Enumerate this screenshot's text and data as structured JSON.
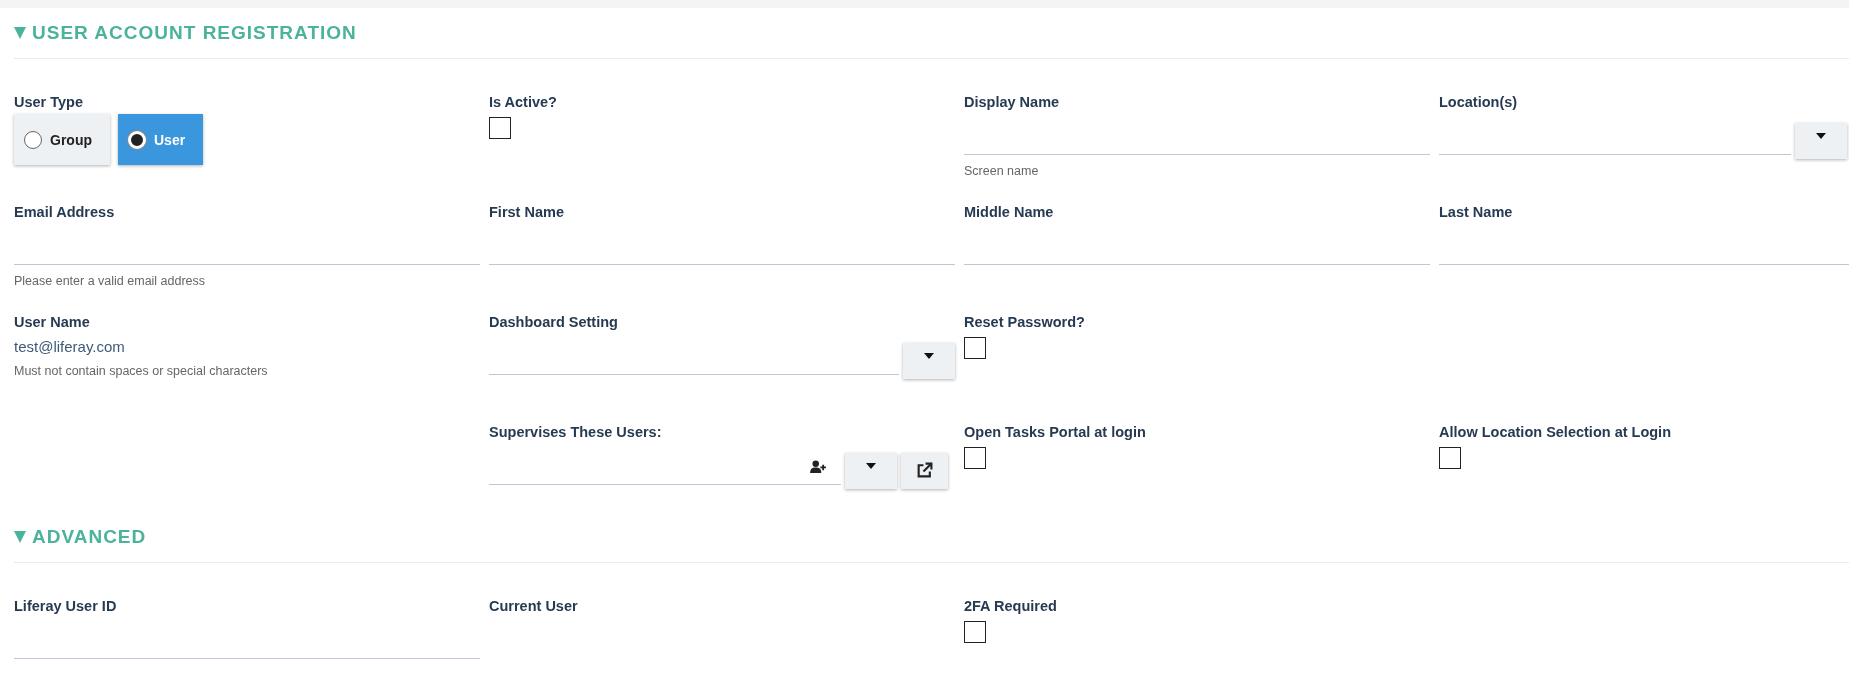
{
  "sections": [
    {
      "title": "USER ACCOUNT REGISTRATION",
      "expanded": true,
      "rows": [
        [
          {
            "kind": "radio-group",
            "label": "User Type",
            "options": [
              {
                "label": "Group",
                "selected": false
              },
              {
                "label": "User",
                "selected": true
              }
            ]
          },
          {
            "kind": "checkbox",
            "label": "Is Active?",
            "checked": false
          },
          {
            "kind": "text",
            "label": "Display Name",
            "help": "Screen name"
          },
          {
            "kind": "picker",
            "label": "Location(s)"
          }
        ],
        [
          {
            "kind": "text",
            "label": "Email Address",
            "help": "Please enter a valid email address"
          },
          {
            "kind": "text",
            "label": "First Name"
          },
          {
            "kind": "text",
            "label": "Middle Name"
          },
          {
            "kind": "text",
            "label": "Last Name"
          }
        ],
        [
          {
            "kind": "static",
            "label": "User Name",
            "value": "test@liferay.com",
            "help": "Must not contain spaces or special characters"
          },
          {
            "kind": "select",
            "label": "Dashboard Setting"
          },
          {
            "kind": "checkbox",
            "label": "Reset Password?",
            "checked": false
          }
        ],
        [
          "",
          {
            "kind": "user-picker",
            "label": "Supervises These Users:"
          },
          {
            "kind": "checkbox",
            "label": "Open Tasks Portal at login",
            "checked": false
          },
          {
            "kind": "checkbox",
            "label": "Allow Location Selection at Login",
            "checked": false
          }
        ]
      ]
    },
    {
      "title": "ADVANCED",
      "expanded": true,
      "rows": [
        [
          {
            "kind": "text",
            "label": "Liferay User ID"
          },
          {
            "kind": "static",
            "label": "Current User"
          },
          {
            "kind": "checkbox",
            "label": "2FA Required",
            "checked": false
          }
        ]
      ]
    }
  ]
}
